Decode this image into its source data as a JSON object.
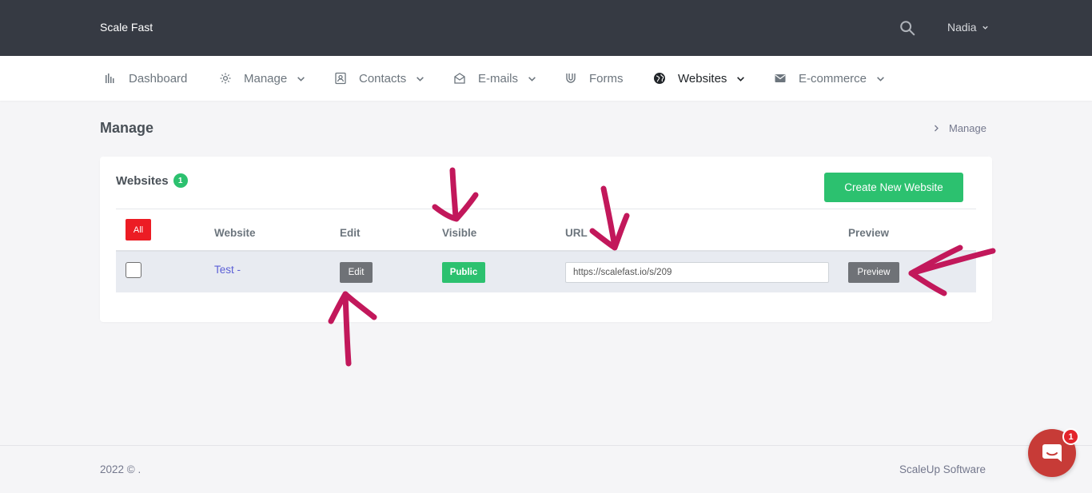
{
  "app": {
    "brand": "Scale Fast",
    "user_name": "Nadia"
  },
  "nav": {
    "items": [
      {
        "label": "Dashboard",
        "icon": "bar-chart-icon",
        "dropdown": false
      },
      {
        "label": "Manage",
        "icon": "gear-icon",
        "dropdown": true
      },
      {
        "label": "Contacts",
        "icon": "contact-card-icon",
        "dropdown": true
      },
      {
        "label": "E-mails",
        "icon": "envelope-open-icon",
        "dropdown": true
      },
      {
        "label": "Forms",
        "icon": "magnet-icon",
        "dropdown": false
      },
      {
        "label": "Websites",
        "icon": "globe-icon",
        "dropdown": true,
        "active": true
      },
      {
        "label": "E-commerce",
        "icon": "envelope-icon",
        "dropdown": true
      }
    ]
  },
  "page": {
    "title": "Manage",
    "breadcrumb": "Manage"
  },
  "websites": {
    "title": "Websites",
    "count": "1",
    "create_button": "Create New Website",
    "all_button": "All",
    "columns": [
      "Website",
      "Edit",
      "Visible",
      "URL",
      "Preview"
    ],
    "rows": [
      {
        "website": "Test -",
        "edit_label": "Edit",
        "visible": "Public",
        "url": "https://scalefast.io/s/209",
        "preview_label": "Preview"
      }
    ]
  },
  "footer": {
    "left": "2022 © .",
    "right": "ScaleUp Software"
  },
  "chat": {
    "badge": "1"
  },
  "colors": {
    "topbar": "#363a43",
    "accent_green": "#2cc16f",
    "danger_red": "#ec1c24",
    "link_purple": "#5b5fd6",
    "annotation_magenta": "#c2185b"
  }
}
